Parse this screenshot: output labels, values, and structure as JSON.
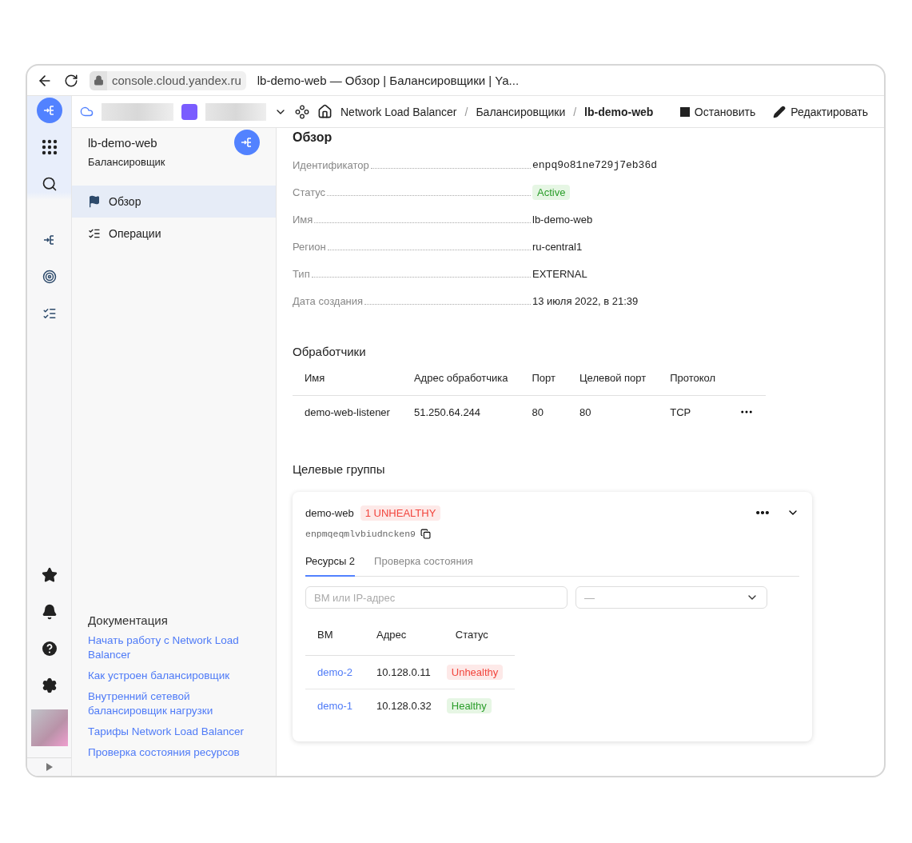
{
  "browser": {
    "url": "console.cloud.yandex.ru",
    "title": "lb-demo-web — Обзор | Балансировщики | Ya..."
  },
  "breadcrumb_separator": "/",
  "breadcrumbs": [
    {
      "label": "Network Load Balancer",
      "current": false
    },
    {
      "label": "Балансировщики",
      "current": false
    },
    {
      "label": "lb-demo-web",
      "current": true
    }
  ],
  "actions": [
    {
      "kind": "stop",
      "label": "Остановить"
    },
    {
      "kind": "edit",
      "label": "Редактировать"
    }
  ],
  "sidebar": {
    "title": "lb-demo-web",
    "subtitle": "Балансировщик",
    "items": [
      {
        "kind": "overview",
        "label": "Обзор",
        "selected": true
      },
      {
        "kind": "operations",
        "label": "Операции",
        "selected": false
      }
    ],
    "docs_title": "Документация",
    "docs": [
      "Начать работу с Network Load Balancer",
      "Как устроен балансировщик",
      "Внутренний сетевой балансировщик нагрузки",
      "Тарифы Network Load Balancer",
      "Проверка состояния ресурсов"
    ]
  },
  "overview": {
    "title": "Обзор",
    "fields": [
      {
        "label": "Идентификатор",
        "value": "enpq9o81ne729j7eb36d",
        "kind": "mono"
      },
      {
        "label": "Статус",
        "value": "Active",
        "kind": "badge"
      },
      {
        "label": "Имя",
        "value": "lb-demo-web",
        "kind": "text"
      },
      {
        "label": "Регион",
        "value": "ru-central1",
        "kind": "text"
      },
      {
        "label": "Тип",
        "value": "EXTERNAL",
        "kind": "text"
      },
      {
        "label": "Дата создания",
        "value": "13 июля 2022, в 21:39",
        "kind": "text"
      }
    ]
  },
  "listeners": {
    "title": "Обработчики",
    "columns": [
      "Имя",
      "Адрес обработчика",
      "Порт",
      "Целевой порт",
      "Протокол"
    ],
    "rows": [
      [
        "demo-web-listener",
        "51.250.64.244",
        "80",
        "80",
        "TCP"
      ]
    ]
  },
  "target_groups": {
    "title": "Целевые группы",
    "groups": [
      {
        "name": "demo-web",
        "badge": "1 UNHEALTHY",
        "id": "enpmqeqmlvbiudncken9",
        "tabs": [
          {
            "label": "Ресурсы 2",
            "selected": true
          },
          {
            "label": "Проверка состояния",
            "selected": false
          }
        ],
        "search": {
          "placeholder": "ВМ или IP-адрес"
        },
        "select": {
          "placeholder": "—"
        },
        "columns": [
          "ВМ",
          "Адрес",
          "Статус"
        ],
        "rows": [
          {
            "vm": "demo-2",
            "address": "10.128.0.11",
            "status": "Unhealthy",
            "kind": "danger"
          },
          {
            "vm": "demo-1",
            "address": "10.128.0.32",
            "status": "Healthy",
            "kind": "success"
          }
        ]
      }
    ]
  }
}
